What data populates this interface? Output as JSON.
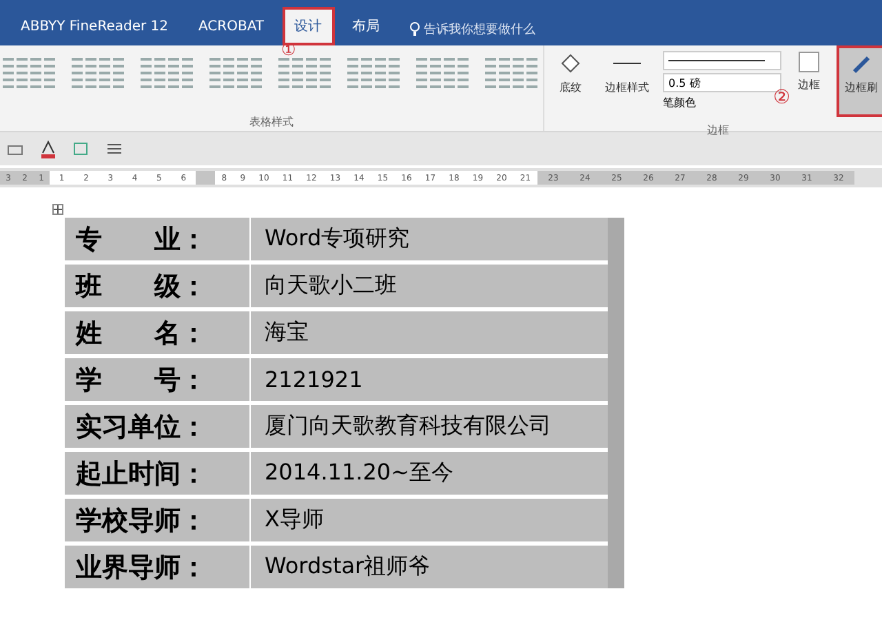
{
  "tabs": [
    {
      "label": "ABBYY FineReader 12",
      "selected": false
    },
    {
      "label": "ACROBAT",
      "selected": false
    },
    {
      "label": "设计",
      "selected": true
    },
    {
      "label": "布局",
      "selected": false
    }
  ],
  "tell_me": {
    "placeholder": "告诉我你想要做什么"
  },
  "callouts": [
    "①",
    "②"
  ],
  "ribbon": {
    "table_styles_label": "表格样式",
    "shading": "底纹",
    "border_styles": "边框样式",
    "pen_weight": "0.5 磅",
    "pen_color": "笔颜色",
    "borders": "边框",
    "border_painter": "边框刷",
    "border_group_label": "边框"
  },
  "ruler": [
    {
      "kind": "margin",
      "marks": [
        "3",
        "2",
        "1"
      ]
    },
    {
      "kind": "text",
      "marks": [
        "1",
        "2",
        "3",
        "4",
        "5",
        "6"
      ]
    },
    {
      "kind": "margin"
    },
    {
      "kind": "text",
      "marks": [
        "8",
        "9",
        "10",
        "11",
        "12",
        "13",
        "14",
        "15",
        "16",
        "17",
        "18",
        "19",
        "20",
        "21"
      ]
    },
    {
      "kind": "margin",
      "marks": [
        "23",
        "24",
        "25",
        "26",
        "27",
        "28",
        "29",
        "30",
        "31",
        "32"
      ]
    }
  ],
  "table": {
    "rows": [
      {
        "label": "专　　业：",
        "value": "Word专项研究"
      },
      {
        "label": "班　　级：",
        "value": "向天歌小二班"
      },
      {
        "label": "姓　　名：",
        "value": "海宝"
      },
      {
        "label": "学　　号：",
        "value": "2121921"
      },
      {
        "label": "实习单位：",
        "value": "厦门向天歌教育科技有限公司"
      },
      {
        "label": "起止时间：",
        "value": "2014.11.20~至今"
      },
      {
        "label": "学校导师：",
        "value": "X导师"
      },
      {
        "label": "业界导师：",
        "value": "Wordstar祖师爷"
      }
    ]
  }
}
